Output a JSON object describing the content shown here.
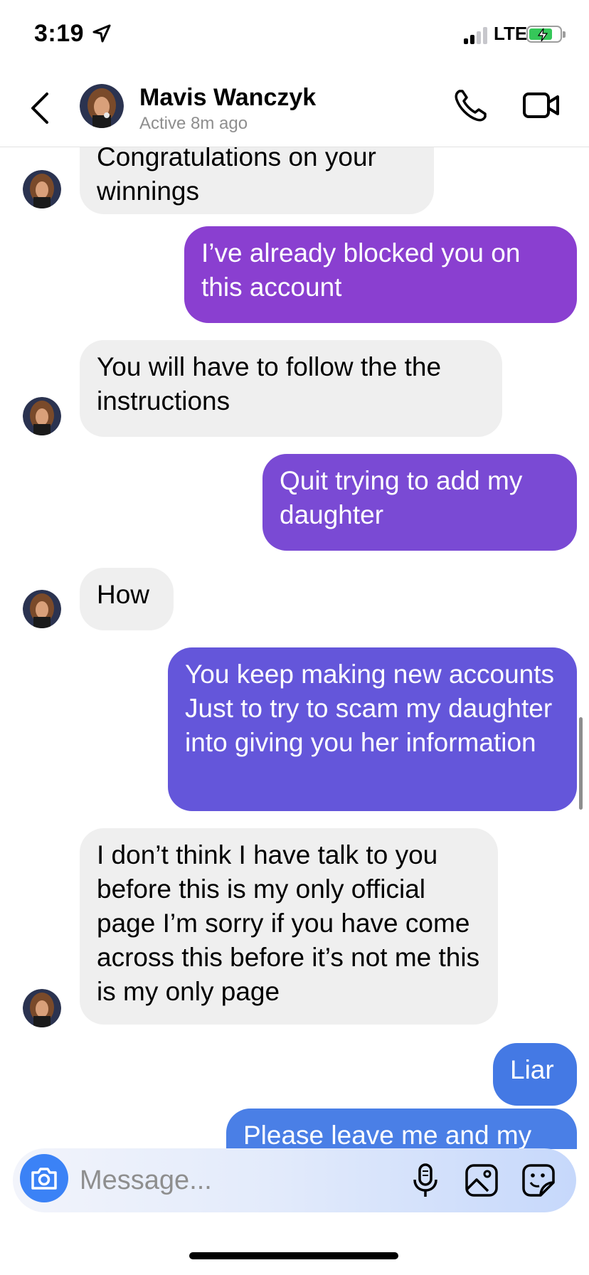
{
  "status_bar": {
    "time": "3:19",
    "network": "LTE"
  },
  "header": {
    "contact_name": "Mavis Wanczyk",
    "contact_status": "Active 8m ago"
  },
  "messages": [
    {
      "direction": "in",
      "text": "Congratulations on your winnings"
    },
    {
      "direction": "out",
      "text": "I’ve already blocked you on this account",
      "color": "#8a3fd0"
    },
    {
      "direction": "in",
      "text": "You will have to follow the the instructions"
    },
    {
      "direction": "out",
      "text": "Quit trying to add my daughter",
      "color": "#7a4ad4"
    },
    {
      "direction": "in",
      "text": "How"
    },
    {
      "direction": "out",
      "text": "You keep making new accounts Just to try to scam my daughter into giving you her information",
      "color": "#6456da"
    },
    {
      "direction": "in",
      "text": "I don’t think I have talk to you before this is my only official page I’m sorry if you have come across this before it’s not me this is my only page"
    },
    {
      "direction": "out",
      "text": "Liar",
      "color": "#4479e4"
    },
    {
      "direction": "out",
      "text": "Please leave me and my",
      "color": "#4a7fe6"
    }
  ],
  "composer": {
    "placeholder": "Message..."
  },
  "icons": {
    "back": "chevron-left-icon",
    "call": "phone-icon",
    "video": "video-camera-icon",
    "camera": "camera-icon",
    "mic": "microphone-icon",
    "gallery": "image-icon",
    "sticker": "sticker-icon"
  },
  "colors": {
    "incoming_bubble": "#efefef",
    "accent": "#3b82f6"
  }
}
